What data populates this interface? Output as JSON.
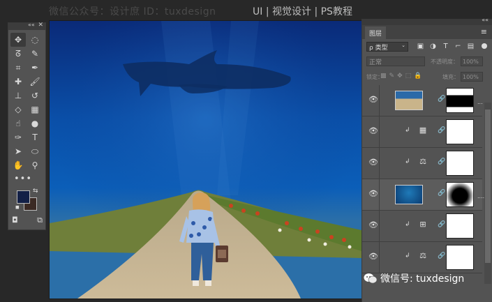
{
  "header": {
    "watermark": "微信公众号：设计庶   ID：tuxdesign",
    "menu_text": "UI | 视觉设计 | PS教程"
  },
  "tools_panel": {
    "collapse_glyph": "««",
    "close_glyph": "✕",
    "tools": [
      {
        "name": "move-tool-icon",
        "glyph": "✥",
        "active": true
      },
      {
        "name": "elliptical-marquee-icon",
        "glyph": "◌"
      },
      {
        "name": "lasso-icon",
        "glyph": "ᘔ"
      },
      {
        "name": "quick-select-icon",
        "glyph": "✎"
      },
      {
        "name": "crop-icon",
        "glyph": "⌗"
      },
      {
        "name": "eyedropper-icon",
        "glyph": "✒"
      },
      {
        "name": "healing-brush-icon",
        "glyph": "✚"
      },
      {
        "name": "brush-icon",
        "glyph": "🖌"
      },
      {
        "name": "clone-stamp-icon",
        "glyph": "⊥"
      },
      {
        "name": "history-brush-icon",
        "glyph": "↺"
      },
      {
        "name": "eraser-icon",
        "glyph": "◇"
      },
      {
        "name": "gradient-icon",
        "glyph": "▦"
      },
      {
        "name": "smudge-icon",
        "glyph": "☝"
      },
      {
        "name": "dodge-icon",
        "glyph": "●"
      },
      {
        "name": "pen-icon",
        "glyph": "✑"
      },
      {
        "name": "type-icon",
        "glyph": "T"
      },
      {
        "name": "path-select-icon",
        "glyph": "➤"
      },
      {
        "name": "ellipse-shape-icon",
        "glyph": "⬭"
      },
      {
        "name": "hand-icon",
        "glyph": "✋"
      },
      {
        "name": "zoom-icon",
        "glyph": "⚲"
      }
    ],
    "more_glyph": "•••",
    "fg_color": "#132046",
    "bg_color": "#3b2a24",
    "swap_glyph": "⇆",
    "reset_glyph": "◼",
    "quickmask_glyph": "◘",
    "screenmode_glyph": "⧉"
  },
  "layers_panel": {
    "collapse_glyph": "««",
    "tab_label": "图层",
    "menu_glyph": "≡",
    "filter": {
      "label": "ρ 类型",
      "chevron": "⌄"
    },
    "filter_icons": [
      "▣",
      "◑",
      "T",
      "⌐",
      "▤"
    ],
    "blend_mode": "正常",
    "opacity_label": "不透明度：",
    "opacity_value": "100%",
    "lock_label": "锁定：",
    "lock_icons": [
      "▩",
      "✎",
      "✥",
      "⬚",
      "🔒"
    ],
    "fill_label": "填充：",
    "fill_value": "100%",
    "layers": [
      {
        "name": "...",
        "type": "image",
        "visible": true
      },
      {
        "name": "",
        "type": "adjustment",
        "adj": "▦",
        "clipped": true,
        "visible": true
      },
      {
        "name": "",
        "type": "adjustment",
        "adj": "⚖",
        "clipped": true,
        "visible": true
      },
      {
        "name": "....",
        "type": "image",
        "visible": true,
        "selected": true
      },
      {
        "name": "",
        "type": "adjustment",
        "adj": "⊞",
        "clipped": true,
        "visible": true
      },
      {
        "name": "",
        "type": "adjustment",
        "adj": "⚖",
        "clipped": true,
        "visible": true
      }
    ]
  },
  "bottom_watermark": {
    "text": "微信号: tuxdesign"
  },
  "icons": {
    "eye": "👁",
    "clip": "↲",
    "chain": "🔗"
  }
}
